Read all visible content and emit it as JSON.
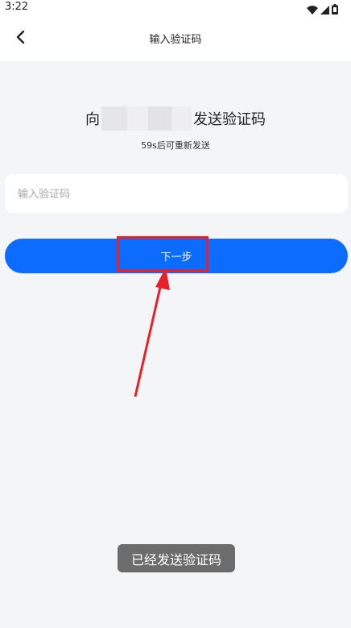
{
  "status_bar": {
    "time": "3:22",
    "icons": [
      "wifi-icon",
      "signal-icon",
      "battery-icon"
    ]
  },
  "nav": {
    "title": "输入验证码",
    "back_icon": "chevron-left-icon"
  },
  "verification": {
    "prefix": "向",
    "suffix": "发送验证码",
    "resend_hint": "59s后可重新发送"
  },
  "code_input": {
    "placeholder": "输入验证码",
    "value": ""
  },
  "next_button": {
    "label": "下一步",
    "color": "#0b6cff"
  },
  "annotation": {
    "color": "#e8202a"
  },
  "toast": {
    "text": "已经发送验证码"
  }
}
